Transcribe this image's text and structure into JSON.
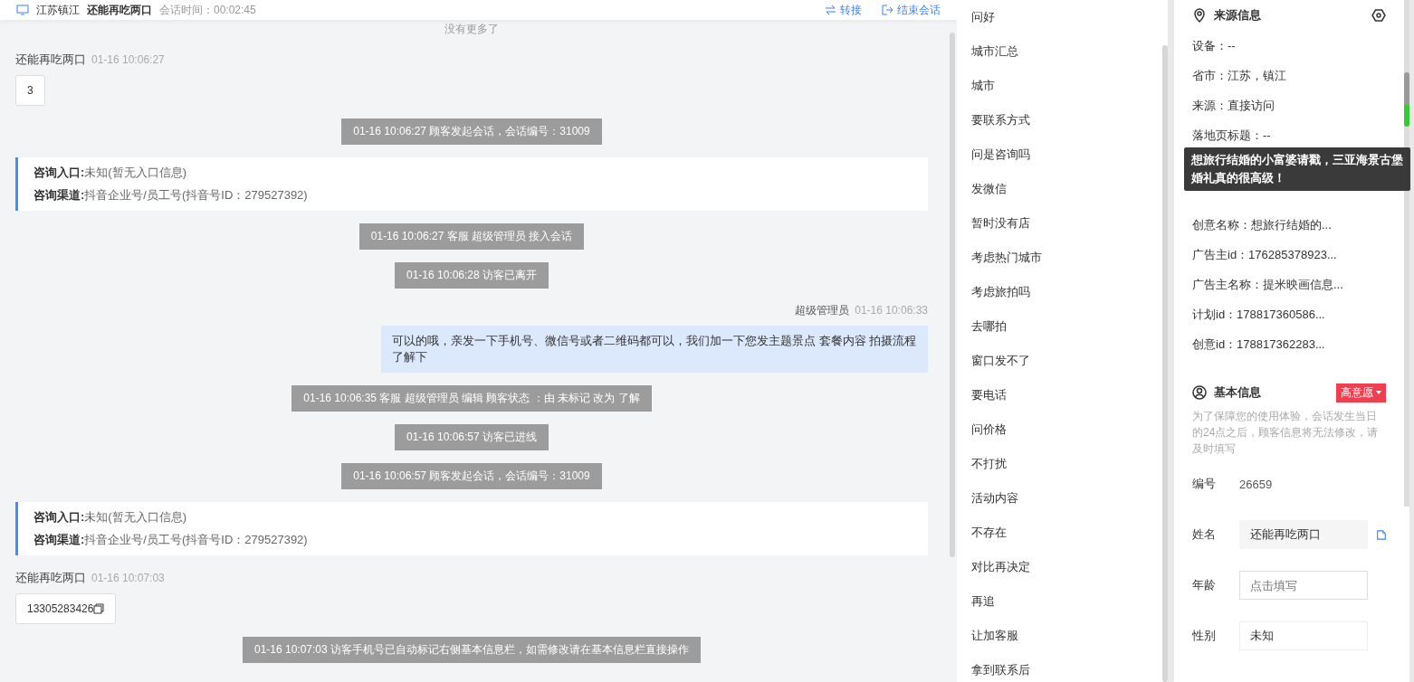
{
  "header": {
    "location": "江苏镇江",
    "visitor": "还能再吃两口",
    "duration": "会话时间：00:02:45",
    "actions": [
      {
        "kind": "transfer",
        "label": "转接"
      },
      {
        "kind": "end",
        "label": "结束会话"
      }
    ]
  },
  "chat": {
    "no_more": "没有更多了",
    "messages": [
      {
        "kind": "visitor",
        "name": "还能再吃两口",
        "time": "01-16 10:06:27",
        "text": "3",
        "copyable": false
      },
      {
        "kind": "system",
        "text": "01-16 10:06:27 顾客发起会话，会话编号：31009"
      },
      {
        "kind": "info",
        "lines": [
          {
            "label": "咨询入口:",
            "value": "未知(暂无入口信息)"
          },
          {
            "label": "咨询渠道:",
            "value": "抖音企业号/员工号(抖音号ID：279527392)"
          }
        ]
      },
      {
        "kind": "system",
        "text": "01-16 10:06:27 客服 超级管理员 接入会话"
      },
      {
        "kind": "system",
        "text": "01-16 10:06:28 访客已离开"
      },
      {
        "kind": "agent",
        "name": "超级管理员",
        "time": "01-16 10:06:33",
        "text": "可以的哦，亲发一下手机号、微信号或者二维码都可以，我们加一下您发主题景点 套餐内容 拍摄流程了解下"
      },
      {
        "kind": "system",
        "text": "01-16 10:06:35 客服 超级管理员 编辑 顾客状态 ：由 未标记 改为 了解"
      },
      {
        "kind": "system",
        "text": "01-16 10:06:57 访客已进线"
      },
      {
        "kind": "system",
        "text": "01-16 10:06:57 顾客发起会话，会话编号：31009"
      },
      {
        "kind": "info",
        "lines": [
          {
            "label": "咨询入口:",
            "value": "未知(暂无入口信息)"
          },
          {
            "label": "咨询渠道:",
            "value": "抖音企业号/员工号(抖音号ID：279527392)"
          }
        ]
      },
      {
        "kind": "visitor",
        "name": "还能再吃两口",
        "time": "01-16 10:07:03",
        "text": "13305283426",
        "copyable": true
      },
      {
        "kind": "system",
        "text": "01-16 10:07:03 访客手机号已自动标记右侧基本信息栏，如需修改请在基本信息栏直接操作"
      }
    ]
  },
  "quick_replies": [
    "问好",
    "城市汇总",
    "城市",
    "要联系方式",
    "问是咨询吗",
    "发微信",
    "暂时没有店",
    "考虑热门城市",
    "考虑旅拍吗",
    "去哪拍",
    "窗口发不了",
    "要电话",
    "问价格",
    "不打扰",
    "活动内容",
    "不存在",
    "对比再决定",
    "再追",
    "让加客服",
    "拿到联系后"
  ],
  "source_info": {
    "title": "来源信息",
    "fields_top": [
      "设备：--",
      "省市：江苏，镇江",
      "来源：直接访问",
      "落地页标题：--"
    ],
    "tooltip": "想旅行结婚的小富婆请戳，三亚海景古堡婚礼真的很高级！",
    "fields_bottom": [
      "创意名称：想旅行结婚的...",
      "广告主id：176285378923...",
      "广告主名称：提米映画信息...",
      "计划id：178817360586...",
      "创意id：178817362283..."
    ]
  },
  "basic_info": {
    "title": "基本信息",
    "intent_tag": "高意愿",
    "notice": "为了保障您的使用体验，会话发生当日的24点之后，顾客信息将无法修改，请及时填写",
    "fields": [
      {
        "kind": "text",
        "label": "编号",
        "value": "26659"
      },
      {
        "kind": "input",
        "label": "姓名",
        "value": "还能再吃两口",
        "copyable": true
      },
      {
        "kind": "input",
        "label": "年龄",
        "placeholder": "点击填写",
        "copyable": false
      },
      {
        "kind": "select",
        "label": "性别",
        "value": "未知"
      }
    ]
  }
}
